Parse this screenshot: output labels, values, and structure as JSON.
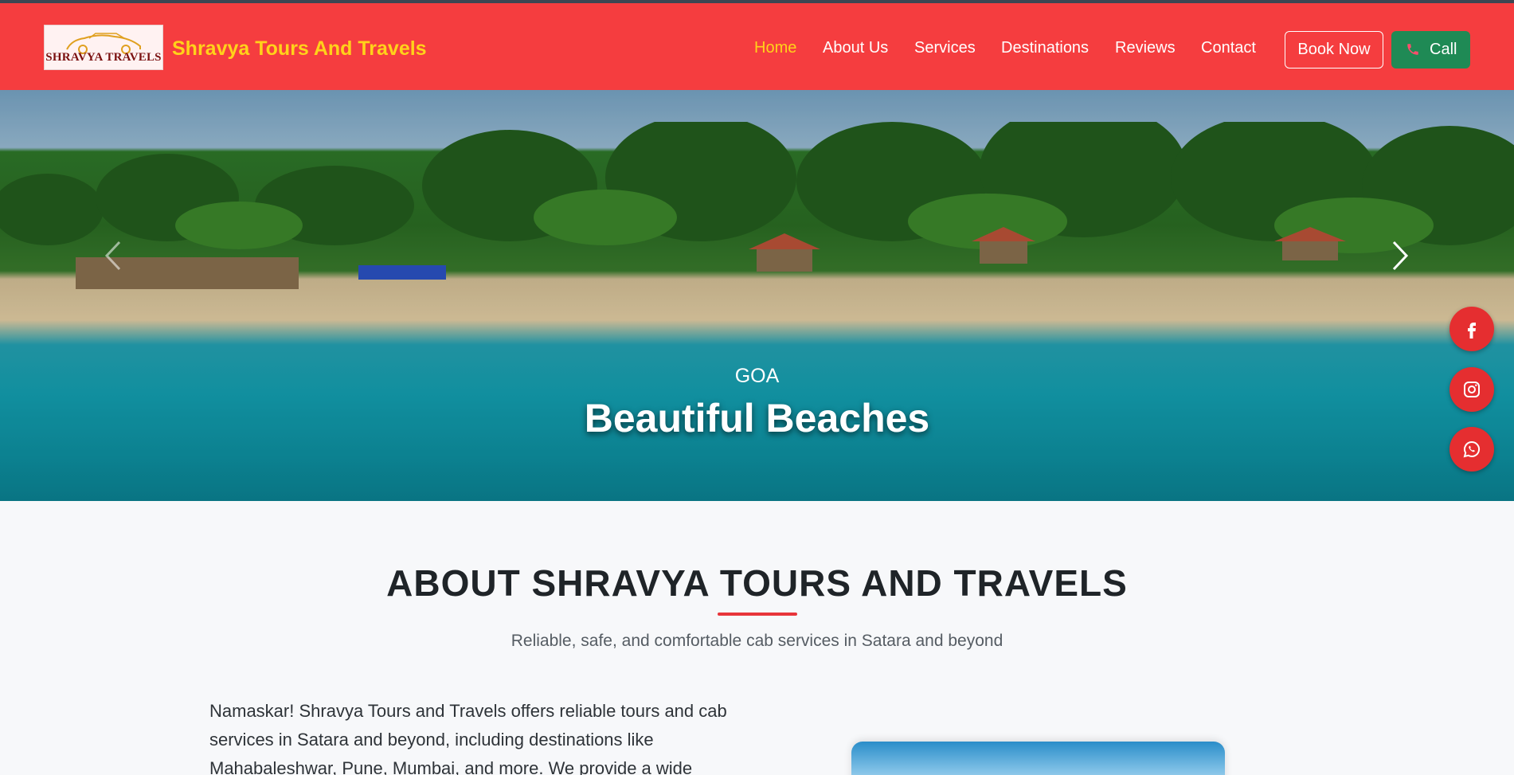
{
  "header": {
    "logo_text": "SHRAVYA TRAVELS",
    "brand": "Shravya Tours And Travels",
    "nav": [
      {
        "label": "Home",
        "active": true
      },
      {
        "label": "About Us"
      },
      {
        "label": "Services"
      },
      {
        "label": "Destinations"
      },
      {
        "label": "Reviews"
      },
      {
        "label": "Contact"
      }
    ],
    "book_label": "Book Now",
    "call_label": "Call",
    "call_icon": "phone-icon",
    "colors": {
      "bar": "#f53d3f",
      "accent": "#ffd21a",
      "call": "#1f8a55"
    }
  },
  "hero": {
    "subtitle": "GOA",
    "title": "Beautiful Beaches",
    "prev_icon": "chevron-left-icon",
    "next_icon": "chevron-right-icon"
  },
  "social": [
    {
      "icon": "facebook-icon"
    },
    {
      "icon": "instagram-icon"
    },
    {
      "icon": "whatsapp-icon"
    }
  ],
  "about": {
    "title": "ABOUT SHRAVYA TOURS AND TRAVELS",
    "tagline": "Reliable, safe, and comfortable cab services in Satara and beyond",
    "paragraph": "Namaskar! Shravya Tours and Travels offers reliable tours and cab services in Satara and beyond, including destinations like Mahabaleshwar, Pune, Mumbai, and more. We provide a wide"
  }
}
